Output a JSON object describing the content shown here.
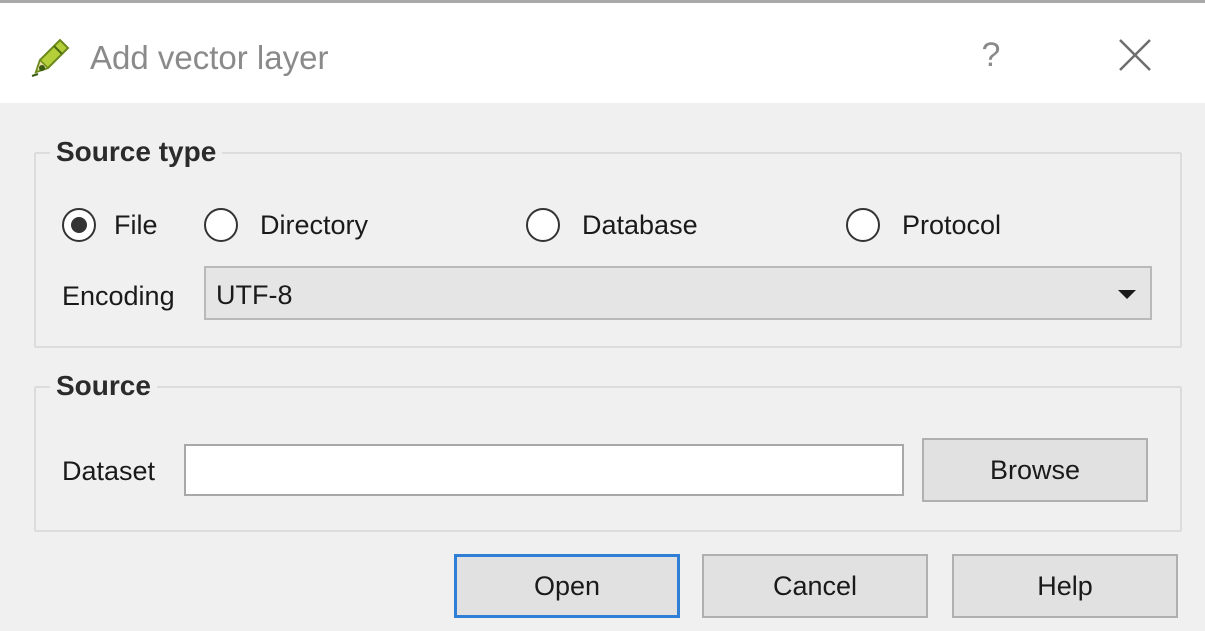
{
  "window": {
    "title": "Add vector layer",
    "help_glyph": "?",
    "icon": "qgis-pencil-icon"
  },
  "source_type": {
    "title": "Source type",
    "options": [
      {
        "label": "File",
        "checked": true
      },
      {
        "label": "Directory",
        "checked": false
      },
      {
        "label": "Database",
        "checked": false
      },
      {
        "label": "Protocol",
        "checked": false
      }
    ],
    "encoding_label": "Encoding",
    "encoding_value": "UTF-8"
  },
  "source": {
    "title": "Source",
    "dataset_label": "Dataset",
    "dataset_value": "",
    "browse_label": "Browse"
  },
  "buttons": {
    "open": "Open",
    "cancel": "Cancel",
    "help": "Help"
  },
  "colors": {
    "accent": "#2f7fd6",
    "background": "#f0f0f0",
    "titlebar": "#ffffff"
  }
}
